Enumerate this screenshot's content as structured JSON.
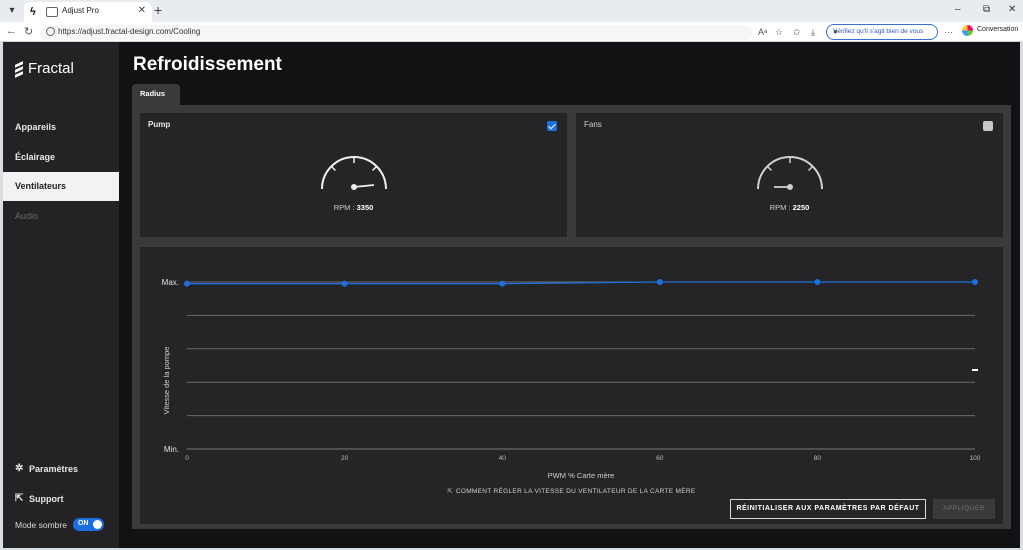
{
  "browser": {
    "tab_title": "Adjust Pro",
    "url": "https://adjust.fractal-design.com/Cooling",
    "verify_label": "Vérifiez qu'il s'agit bien de vous",
    "conversation_label": "Conversation",
    "new_tab": "+",
    "minimize": "–",
    "maximize": "⧉",
    "close": "✕"
  },
  "brand": {
    "name": "Fractal"
  },
  "sidebar": {
    "items": [
      {
        "label": "Appareils",
        "state": "normal"
      },
      {
        "label": "Éclairage",
        "state": "normal"
      },
      {
        "label": "Ventilateurs",
        "state": "active"
      },
      {
        "label": "Audio",
        "state": "disabled"
      }
    ],
    "settings_label": "Paramètres",
    "support_label": "Support",
    "dark_mode_label": "Mode sombre",
    "dark_mode_state": "ON"
  },
  "page": {
    "title": "Refroidissement",
    "device_tab": "Radius"
  },
  "cards": {
    "pump": {
      "title": "Pump",
      "checked": true,
      "rpm_label": "RPM : ",
      "rpm_value": "3350"
    },
    "fans": {
      "title": "Fans",
      "checked": false,
      "rpm_label": "RPM : ",
      "rpm_value": "2250"
    }
  },
  "chart_data": {
    "type": "line",
    "xlabel": "PWM % Carte mère",
    "ylabel": "Vitesse de la pompe",
    "x_ticks": [
      "0",
      "20",
      "40",
      "60",
      "80",
      "100"
    ],
    "y_ticks": [
      "Min.",
      "Max."
    ],
    "xlim": [
      0,
      100
    ],
    "ylim": [
      0,
      100
    ],
    "grid": true,
    "series": [
      {
        "x": [
          0,
          20,
          40,
          60,
          80,
          100
        ],
        "y": [
          99,
          99,
          99,
          100,
          100,
          100
        ]
      }
    ],
    "accent": "#1d6fe0"
  },
  "footer": {
    "howto_label": "COMMENT RÉGLER LA VITESSE DU VENTILATEUR DE LA CARTE MÈRE",
    "reset_label": "RÉINITIALISER AUX PARAMÈTRES PAR DÉFAUT",
    "apply_label": "APPLIQUER"
  }
}
